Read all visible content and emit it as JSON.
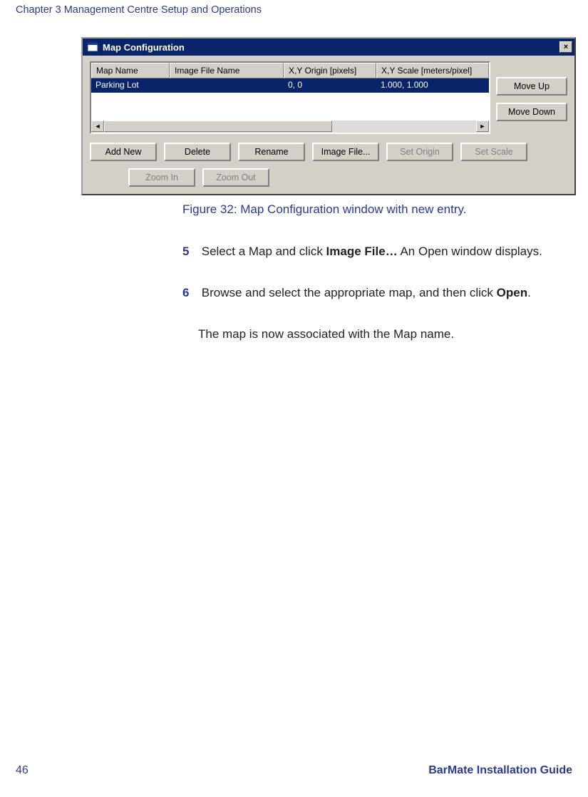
{
  "header": "Chapter 3 Management Centre Setup and Operations",
  "dialog": {
    "title": "Map Configuration",
    "columns": {
      "name": "Map Name",
      "file": "Image File Name",
      "origin": "X,Y Origin [pixels]",
      "scale": "X,Y Scale [meters/pixel]"
    },
    "row": {
      "name": "Parking Lot",
      "file": "",
      "origin": "0, 0",
      "scale": "1.000, 1.000"
    },
    "buttons": {
      "moveUp": "Move Up",
      "moveDown": "Move Down",
      "addNew": "Add New",
      "delete": "Delete",
      "rename": "Rename",
      "imageFile": "Image File...",
      "setOrigin": "Set Origin",
      "setScale": "Set Scale",
      "zoomIn": "Zoom In",
      "zoomOut": "Zoom Out"
    },
    "close": "×"
  },
  "caption": "Figure 32: Map Configuration window with new entry.",
  "steps": {
    "s5num": "5",
    "s5a": "Select a Map and click ",
    "s5bold": "Image File…",
    "s5b": "  An Open window displays.",
    "s6num": "6",
    "s6a": "Browse and select the appropriate map, and then click ",
    "s6bold": "Open",
    "s6b": ".",
    "followup": "The map is now associated with the Map name."
  },
  "footer": {
    "page": "46",
    "title": "BarMate Installation Guide"
  }
}
